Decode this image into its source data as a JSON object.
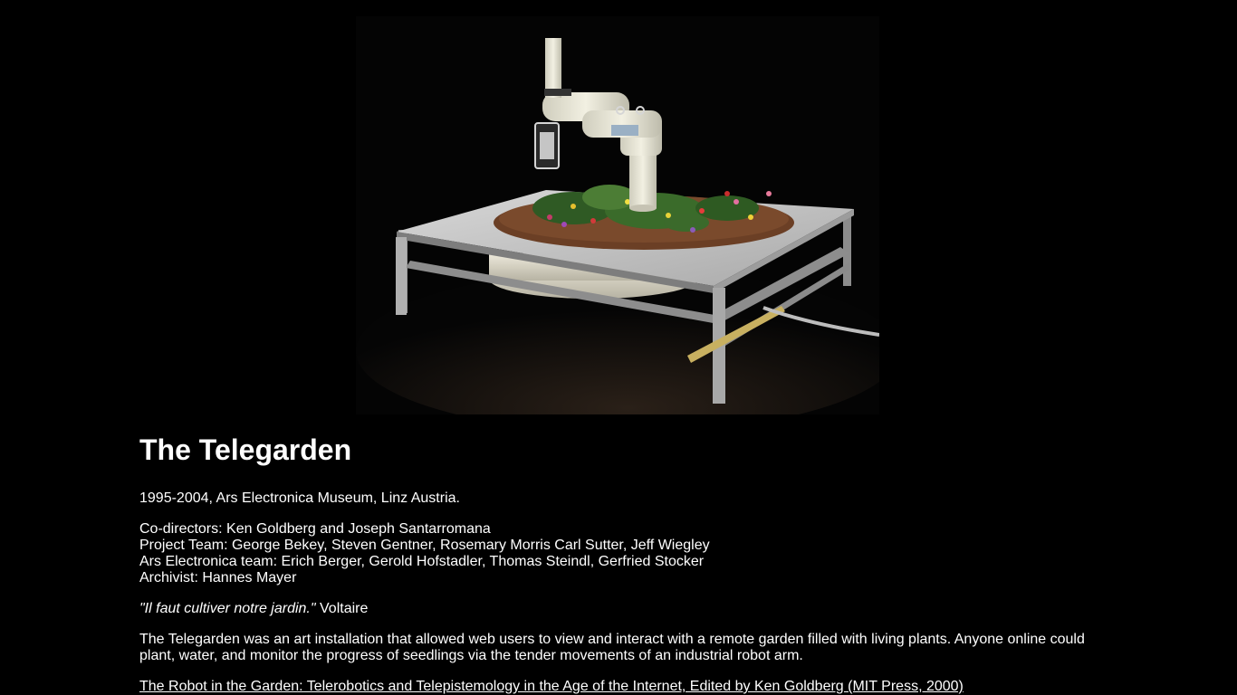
{
  "page": {
    "title": "The Telegarden",
    "dates_location": "1995-2004, Ars Electronica Museum, Linz Austria.",
    "credits": {
      "co_directors": "Co-directors: Ken Goldberg and Joseph Santarromana",
      "project_team": "Project Team: George Bekey, Steven Gentner, Rosemary Morris Carl Sutter, Jeff Wiegley",
      "ars_team": "Ars Electronica team: Erich Berger, Gerold Hofstadler, Thomas Steindl, Gerfried Stocker",
      "archivist": "Archivist: Hannes Mayer"
    },
    "quote": {
      "text": "\"Il faut cultiver notre jardin.\"",
      "author": " Voltaire"
    },
    "description": "The Telegarden was an art installation that allowed web users to view and interact with a remote garden filled with living plants. Anyone online could plant, water, and monitor the progress of seedlings via the tender movements of an industrial robot arm.",
    "book_link": "The Robot in the Garden: Telerobotics and Telepistemology in the Age of the Internet, Edited by Ken Goldberg (MIT Press, 2000)"
  },
  "colors": {
    "background": "#000000",
    "text": "#ffffff"
  }
}
